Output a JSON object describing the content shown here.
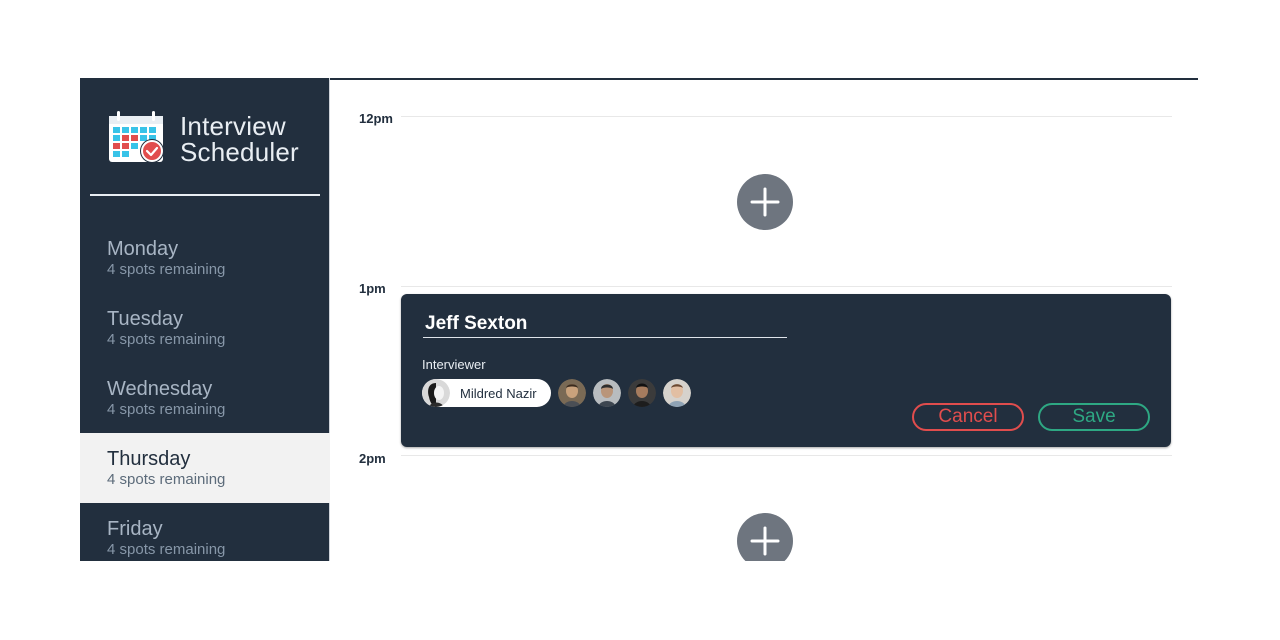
{
  "app": {
    "title_line1": "Interview",
    "title_line2": "Scheduler",
    "logo_icon": "calendar-check-icon"
  },
  "days": [
    {
      "name": "Monday",
      "spots": "4 spots remaining",
      "selected": false
    },
    {
      "name": "Tuesday",
      "spots": "4 spots remaining",
      "selected": false
    },
    {
      "name": "Wednesday",
      "spots": "4 spots remaining",
      "selected": false
    },
    {
      "name": "Thursday",
      "spots": "4 spots remaining",
      "selected": true
    },
    {
      "name": "Friday",
      "spots": "4 spots remaining",
      "selected": false
    }
  ],
  "schedule": {
    "hours": [
      "12pm",
      "1pm",
      "2pm"
    ],
    "add_icon": "plus-icon"
  },
  "form": {
    "student_name": "Jeff Sexton",
    "interviewer_label": "Interviewer",
    "selected_interviewer": "Mildred Nazir",
    "other_interviewers_count": 4,
    "cancel_label": "Cancel",
    "save_label": "Save"
  },
  "colors": {
    "sidebar_bg": "#222f3e",
    "card_bg": "#222f3e",
    "cancel": "#e14d4d",
    "save": "#2ea883",
    "add_button": "#6e757f"
  }
}
